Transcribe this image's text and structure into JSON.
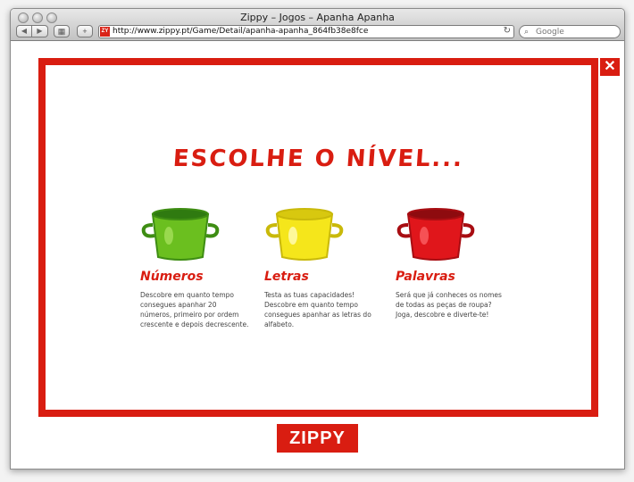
{
  "window": {
    "title": "Zippy – Jogos – Apanha Apanha",
    "url": "http://www.zippy.pt/Game/Detail/apanha-apanha_864fb38e8fce",
    "favicon_text": "ZY",
    "search_placeholder": "Google"
  },
  "game": {
    "heading": "ESCOLHE O NÍVEL...",
    "close_glyph": "✕",
    "levels": [
      {
        "title": "Números",
        "description": "Descobre em quanto tempo consegues apanhar 20 números, primeiro por ordem crescente e depois decrescente.",
        "bucket_color": "#6bbf1f",
        "bucket_rim": "#2f7a10"
      },
      {
        "title": "Letras",
        "description": "Testa as tuas capacidades! Descobre em quanto tempo consegues apanhar as letras do alfabeto.",
        "bucket_color": "#f5e61b",
        "bucket_rim": "#c9b90a"
      },
      {
        "title": "Palavras",
        "description": "Será que já conheces os nomes de todas as peças de roupa? Joga, descobre e diverte-te!",
        "bucket_color": "#e0161b",
        "bucket_rim": "#8e0b0f"
      }
    ]
  },
  "footer": {
    "logo": "ZIPPY"
  },
  "colors": {
    "brand_red": "#d91d11"
  }
}
